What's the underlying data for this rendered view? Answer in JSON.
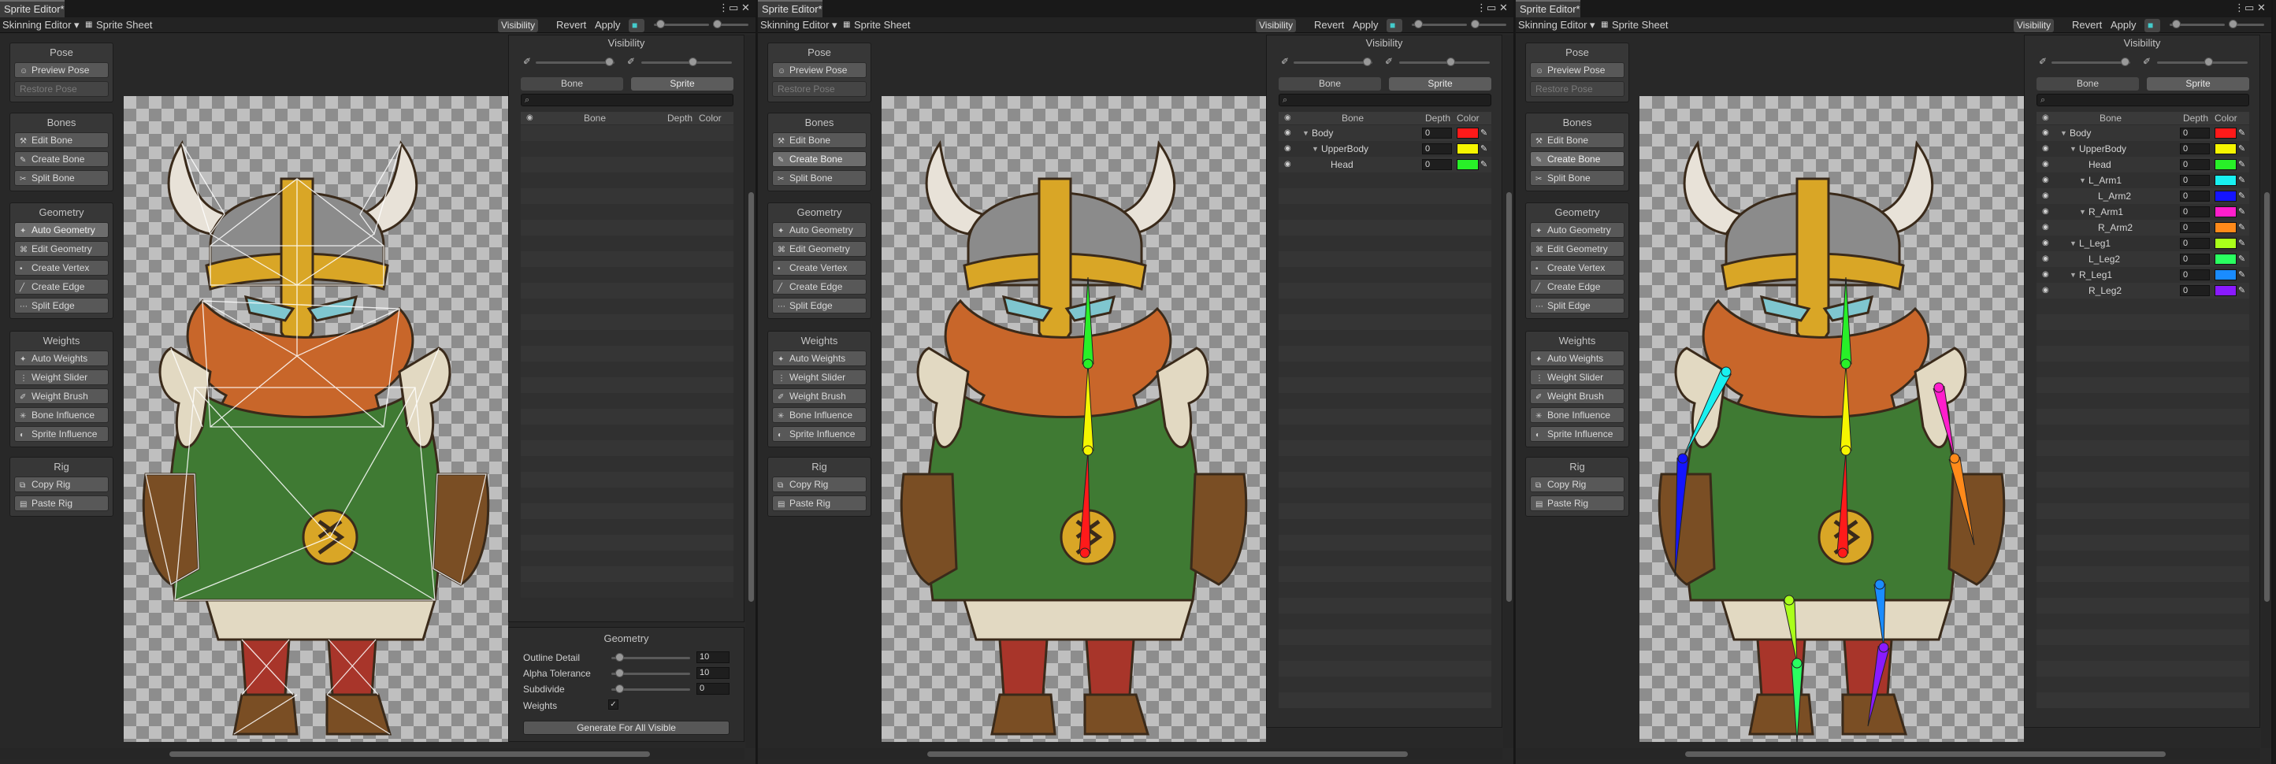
{
  "windows": [
    {
      "id": "w1",
      "mode": "geometry",
      "title": "Sprite Editor*",
      "toolbar": {
        "module": "Skinning Editor ▾",
        "sprite_sheet": "Sprite Sheet",
        "visibility": "Visibility",
        "revert": "Revert",
        "apply": "Apply"
      },
      "right_panel": {
        "title": "Visibility",
        "tab_bone": "Bone",
        "tab_sprite": "Sprite",
        "active_tab": "sprite",
        "search_placeholder": "",
        "col_bone": "Bone",
        "col_depth": "Depth",
        "col_color": "Color",
        "bones": []
      },
      "geometry": {
        "title": "Geometry",
        "outline_label": "Outline Detail",
        "outline_value": "10",
        "alpha_label": "Alpha Tolerance",
        "alpha_value": "10",
        "subdivide_label": "Subdivide",
        "subdivide_value": "0",
        "weights_label": "Weights",
        "weights_checked": true,
        "generate_label": "Generate For All Visible"
      },
      "active_tool": "auto_geometry"
    },
    {
      "id": "w2",
      "mode": "bones3",
      "title": "Sprite Editor*",
      "toolbar": {
        "module": "Skinning Editor ▾",
        "sprite_sheet": "Sprite Sheet",
        "visibility": "Visibility",
        "revert": "Revert",
        "apply": "Apply"
      },
      "right_panel": {
        "title": "Visibility",
        "tab_bone": "Bone",
        "tab_sprite": "Sprite",
        "active_tab": "sprite",
        "search_placeholder": "",
        "col_bone": "Bone",
        "col_depth": "Depth",
        "col_color": "Color",
        "bones": [
          {
            "name": "Body",
            "level": 0,
            "expander": true,
            "depth": "0",
            "color": "#ff1a1a"
          },
          {
            "name": "UpperBody",
            "level": 1,
            "expander": true,
            "depth": "0",
            "color": "#f5f500"
          },
          {
            "name": "Head",
            "level": 2,
            "expander": false,
            "depth": "0",
            "color": "#28f028"
          }
        ]
      },
      "active_tool": "create_bone"
    },
    {
      "id": "w3",
      "mode": "bones_full",
      "title": "Sprite Editor*",
      "toolbar": {
        "module": "Skinning Editor ▾",
        "sprite_sheet": "Sprite Sheet",
        "visibility": "Visibility",
        "revert": "Revert",
        "apply": "Apply"
      },
      "right_panel": {
        "title": "Visibility",
        "tab_bone": "Bone",
        "tab_sprite": "Sprite",
        "active_tab": "sprite",
        "search_placeholder": "",
        "col_bone": "Bone",
        "col_depth": "Depth",
        "col_color": "Color",
        "bones": [
          {
            "name": "Body",
            "level": 0,
            "expander": true,
            "depth": "0",
            "color": "#ff1a1a"
          },
          {
            "name": "UpperBody",
            "level": 1,
            "expander": true,
            "depth": "0",
            "color": "#f5f500"
          },
          {
            "name": "Head",
            "level": 2,
            "expander": false,
            "depth": "0",
            "color": "#28f028"
          },
          {
            "name": "L_Arm1",
            "level": 2,
            "expander": true,
            "depth": "0",
            "color": "#18f0f0"
          },
          {
            "name": "L_Arm2",
            "level": 3,
            "expander": false,
            "depth": "0",
            "color": "#1414ff"
          },
          {
            "name": "R_Arm1",
            "level": 2,
            "expander": true,
            "depth": "0",
            "color": "#ff1ecc"
          },
          {
            "name": "R_Arm2",
            "level": 3,
            "expander": false,
            "depth": "0",
            "color": "#ff8a1a"
          },
          {
            "name": "L_Leg1",
            "level": 1,
            "expander": true,
            "depth": "0",
            "color": "#aaff1a"
          },
          {
            "name": "L_Leg2",
            "level": 2,
            "expander": false,
            "depth": "0",
            "color": "#2aff60"
          },
          {
            "name": "R_Leg1",
            "level": 1,
            "expander": true,
            "depth": "0",
            "color": "#1a8cff"
          },
          {
            "name": "R_Leg2",
            "level": 2,
            "expander": false,
            "depth": "0",
            "color": "#8a1aff"
          }
        ]
      },
      "active_tool": "create_bone"
    }
  ],
  "tools": {
    "pose": {
      "title": "Pose",
      "items": [
        {
          "label": "Preview Pose",
          "icon": "person-icon"
        },
        {
          "label": "Restore Pose",
          "icon": "",
          "disabled": true
        }
      ]
    },
    "bones": {
      "title": "Bones",
      "items": [
        {
          "label": "Edit Bone",
          "icon": "bone-edit-icon"
        },
        {
          "label": "Create Bone",
          "icon": "bone-create-icon"
        },
        {
          "label": "Split Bone",
          "icon": "bone-split-icon"
        }
      ]
    },
    "geometry": {
      "title": "Geometry",
      "items": [
        {
          "label": "Auto Geometry",
          "icon": "auto-geometry-icon"
        },
        {
          "label": "Edit Geometry",
          "icon": "edit-geometry-icon"
        },
        {
          "label": "Create Vertex",
          "icon": "create-vertex-icon"
        },
        {
          "label": "Create Edge",
          "icon": "create-edge-icon"
        },
        {
          "label": "Split Edge",
          "icon": "split-edge-icon"
        }
      ]
    },
    "weights": {
      "title": "Weights",
      "items": [
        {
          "label": "Auto Weights",
          "icon": "auto-weights-icon"
        },
        {
          "label": "Weight Slider",
          "icon": "weight-slider-icon"
        },
        {
          "label": "Weight Brush",
          "icon": "weight-brush-icon"
        },
        {
          "label": "Bone Influence",
          "icon": "bone-influence-icon"
        },
        {
          "label": "Sprite Influence",
          "icon": "sprite-influence-icon"
        }
      ]
    },
    "rig": {
      "title": "Rig",
      "items": [
        {
          "label": "Copy Rig",
          "icon": "copy-icon"
        },
        {
          "label": "Paste Rig",
          "icon": "paste-icon"
        }
      ]
    }
  }
}
